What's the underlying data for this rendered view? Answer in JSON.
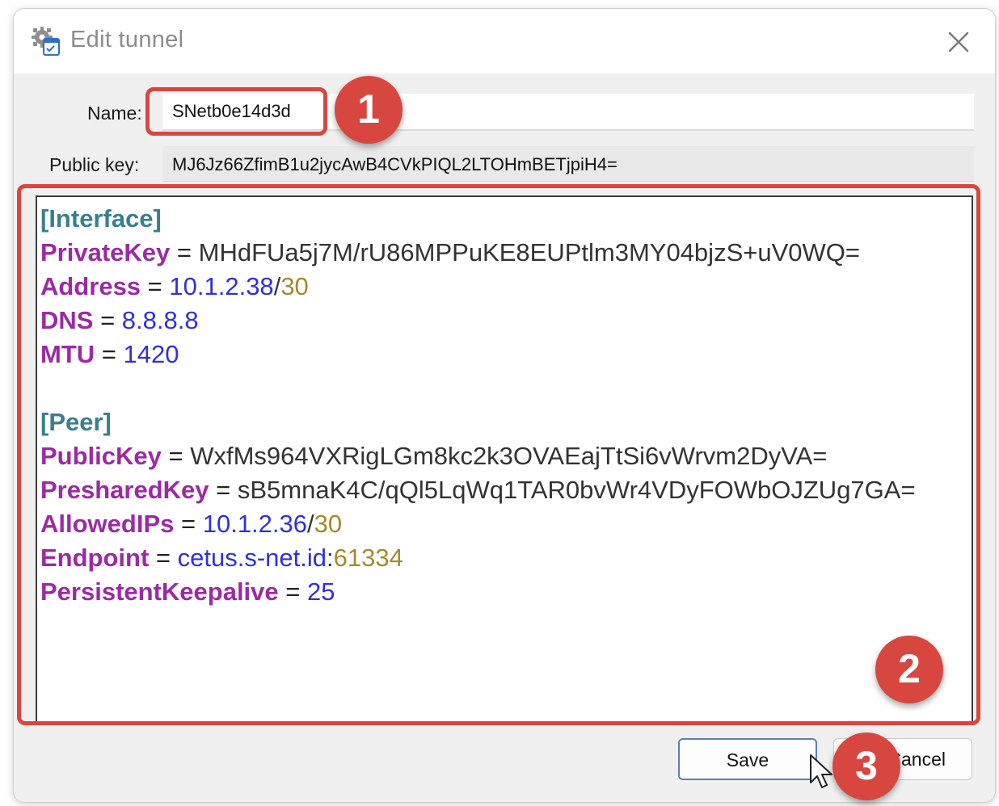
{
  "window": {
    "title": "Edit tunnel",
    "app_icon": "gear-document-icon",
    "close_icon": "close-icon"
  },
  "form": {
    "name_label": "Name:",
    "name_value": "SNetb0e14d3d",
    "public_key_label": "Public key:",
    "public_key_value": "MJ6Jz66ZfimB1u2jycAwB4CVkPIQL2LTOHmBETjpiH4="
  },
  "config": {
    "interface_header": "[Interface]",
    "private_key": {
      "key": "PrivateKey",
      "eq": " = ",
      "value": "MHdFUa5j7M/rU86MPPuKE8EUPtlm3MY04bjzS+uV0WQ="
    },
    "address": {
      "key": "Address",
      "eq": " = ",
      "ip": "10.1.2.38",
      "slash": "/",
      "cidr": "30"
    },
    "dns": {
      "key": "DNS",
      "eq": " = ",
      "value": "8.8.8.8"
    },
    "mtu": {
      "key": "MTU",
      "eq": " = ",
      "value": "1420"
    },
    "peer_header": "[Peer]",
    "public_key": {
      "key": "PublicKey",
      "eq": " = ",
      "value": "WxfMs964VXRigLGm8kc2k3OVAEajTtSi6vWrvm2DyVA="
    },
    "preshared_key": {
      "key": "PresharedKey",
      "eq": " = ",
      "value": "sB5mnaK4C/qQl5LqWq1TAR0bvWr4VDyFOWbOJZUg7GA="
    },
    "allowed_ips": {
      "key": "AllowedIPs",
      "eq": " = ",
      "ip": "10.1.2.36",
      "slash": "/",
      "cidr": "30"
    },
    "endpoint": {
      "key": "Endpoint",
      "eq": " = ",
      "host": "cetus.s-net.id",
      "colon": ":",
      "port": "61334"
    },
    "keepalive": {
      "key": "PersistentKeepalive",
      "eq": " = ",
      "value": "25"
    }
  },
  "buttons": {
    "save_label": "Save",
    "cancel_label": "Cancel"
  },
  "annotations": {
    "badge1": "1",
    "badge2": "2",
    "badge3": "3",
    "color": "#d8473f"
  },
  "colors": {
    "section": "#3a7f8c",
    "key": "#9b2aa3",
    "number": "#2f2fe0",
    "cidr": "#a48a2a"
  }
}
